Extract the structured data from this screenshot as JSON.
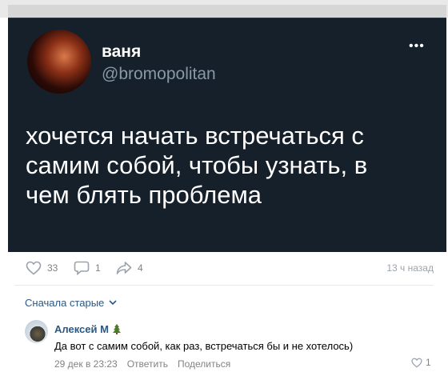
{
  "tweet": {
    "name": "ваня",
    "handle": "@bromopolitan",
    "more": "•••",
    "text_lines": [
      "хочется начать встречаться с",
      "самим собой, чтобы узнать, в",
      "чем блять проблема"
    ]
  },
  "post_actions": {
    "likes": "33",
    "comments": "1",
    "shares": "4",
    "time": "13 ч назад"
  },
  "comments_section": {
    "sort_label": "Сначала старые",
    "comments": [
      {
        "author": "Алексей М",
        "text": "Да вот с самим собой, как раз, встречаться бы и не хотелось)",
        "date": "29 дек в 23:23",
        "reply_label": "Ответить",
        "share_label": "Поделиться",
        "likes": "1"
      }
    ]
  },
  "colors": {
    "tweet_bg": "#15202b",
    "link": "#2a5885",
    "muted": "#828282"
  }
}
